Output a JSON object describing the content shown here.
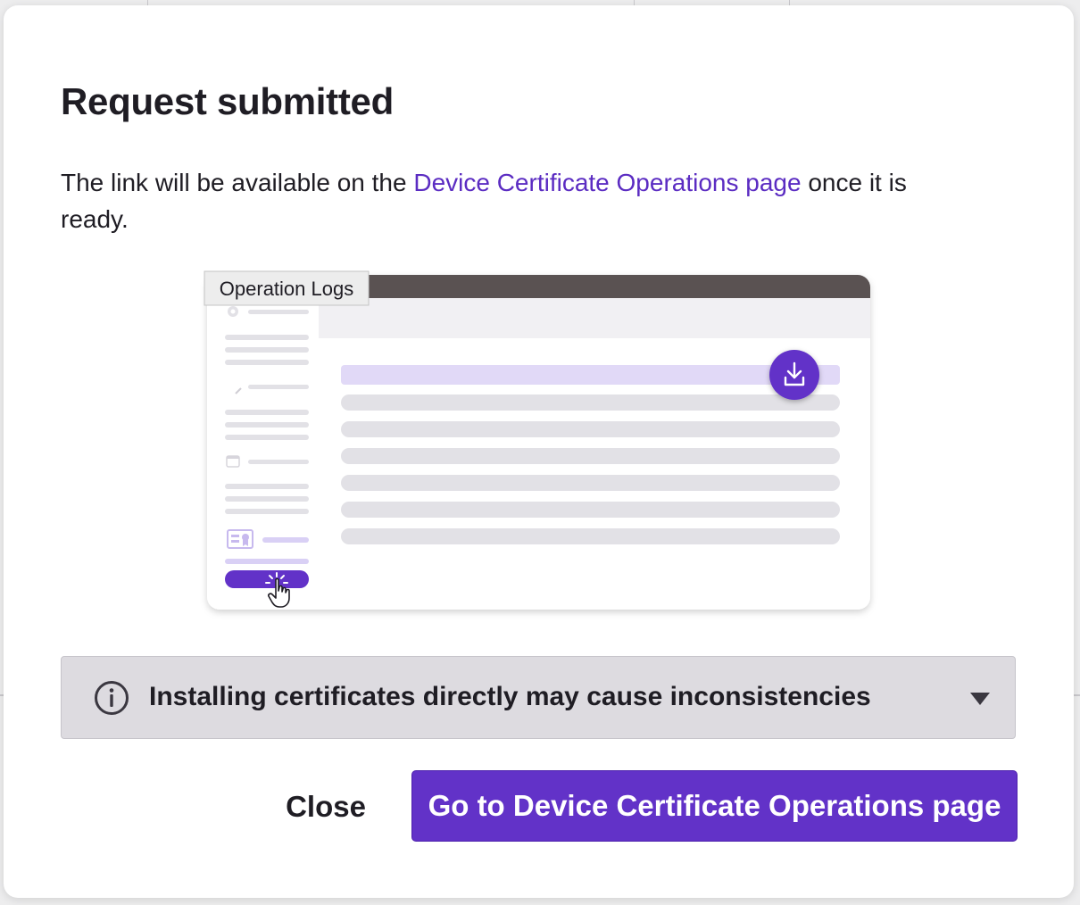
{
  "dialog": {
    "title": "Request submitted",
    "description": {
      "before": "The link will be available on the ",
      "link": "Device Certificate Operations page",
      "after": " once it is ready."
    },
    "illustration": {
      "tooltip": "Operation Logs",
      "icons": [
        "gear-icon",
        "wrench-icon",
        "calendar-icon",
        "certificate-icon",
        "download-icon",
        "pointer-hand-icon"
      ]
    },
    "info": {
      "icon": "info-icon",
      "text": "Installing certificates directly may cause inconsistencies",
      "toggle_icon": "chevron-down-icon"
    },
    "buttons": {
      "close": "Close",
      "primary": "Go to Device Certificate Operations page"
    }
  },
  "colors": {
    "accent": "#6232c8",
    "link": "#5b2cc2",
    "info_bg": "#dddbe0",
    "illus_topbar": "#5a5252",
    "illus_highlight": "#e1d9f7"
  }
}
